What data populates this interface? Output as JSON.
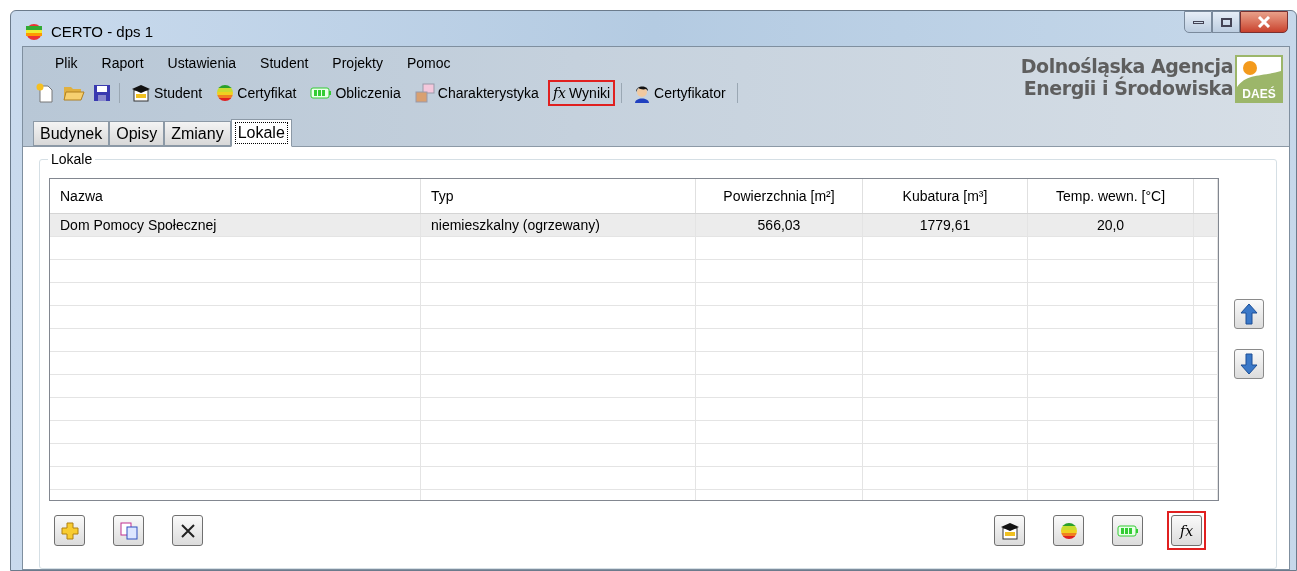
{
  "window": {
    "title": "CERTO - dps 1"
  },
  "menu": [
    {
      "label": "Plik"
    },
    {
      "label": "Raport"
    },
    {
      "label": "Ustawienia"
    },
    {
      "label": "Student"
    },
    {
      "label": "Projekty"
    },
    {
      "label": "Pomoc"
    }
  ],
  "toolbar": [
    {
      "kind": "new"
    },
    {
      "kind": "open"
    },
    {
      "kind": "save"
    },
    {
      "kind": "separator"
    },
    {
      "kind": "student",
      "label": "Student",
      "highlighted": false
    },
    {
      "kind": "certificate",
      "label": "Certyfikat",
      "highlighted": false
    },
    {
      "kind": "battery",
      "label": "Obliczenia",
      "highlighted": false
    },
    {
      "kind": "chart",
      "label": "Charakterystyka",
      "highlighted": false
    },
    {
      "kind": "formula",
      "label": "Wyniki",
      "glyph": "fx",
      "highlighted": true
    },
    {
      "kind": "separator"
    },
    {
      "kind": "person",
      "label": "Certyfikator",
      "highlighted": false
    },
    {
      "kind": "separator"
    }
  ],
  "logo": {
    "line_1": "Dolnośląska Agencja",
    "line_2": "Energii i Środowiska",
    "mark": "DAEŚ"
  },
  "tabs": [
    {
      "label": "Budynek",
      "selected": false
    },
    {
      "label": "Opisy",
      "selected": false
    },
    {
      "label": "Zmiany",
      "selected": false
    },
    {
      "label": "Lokale",
      "selected": true
    }
  ],
  "group": {
    "title": "Lokale"
  },
  "table": {
    "columns": [
      "Nazwa",
      "Typ",
      "Powierzchnia [m²]",
      "Kubatura [m³]",
      "Temp. wewn. [°C]"
    ],
    "rows": [
      {
        "cells": [
          "Dom Pomocy Społecznej",
          "niemieszkalny (ogrzewany)",
          "566,03",
          "1779,61",
          "20,0"
        ],
        "selected": true
      }
    ]
  },
  "bottom_left_buttons": [
    {
      "kind": "add"
    },
    {
      "kind": "copy"
    },
    {
      "kind": "delete"
    }
  ],
  "bottom_right_buttons": [
    {
      "kind": "student",
      "highlighted": false
    },
    {
      "kind": "certificate",
      "highlighted": false
    },
    {
      "kind": "battery",
      "highlighted": false
    },
    {
      "kind": "formula",
      "glyph": "fx",
      "highlighted": true
    }
  ]
}
